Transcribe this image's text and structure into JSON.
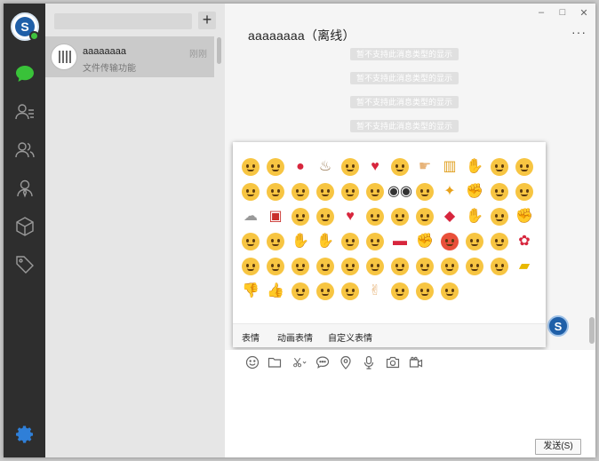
{
  "chat": {
    "title": "aaaaaaaa（离线）",
    "more": "···",
    "unsupported_messages": [
      "暂不支持此消息类型的显示",
      "暂不支持此消息类型的显示",
      "暂不支持此消息类型的显示",
      "暂不支持此消息类型的显示"
    ]
  },
  "window_controls": {
    "minimize": "–",
    "maximize": "□",
    "close": "✕"
  },
  "conversation": {
    "name": "aaaaaaaa",
    "preview": "文件传输功能",
    "time": "刚刚"
  },
  "list": {
    "add_label": "+"
  },
  "emoji_panel": {
    "tabs": [
      "表情",
      "动画表情",
      "自定义表情"
    ],
    "colors": {
      "face": "#f7c542",
      "red": "#d7263d",
      "skin": "#e7b47a"
    },
    "items": [
      "angry-face",
      "kissing-face",
      "balloon",
      "birthday-cake",
      "smiling-face",
      "broken-heart",
      "kiss-face",
      "pointing-hand",
      "beer-mug",
      "handshake",
      "fearful-face",
      "persevering-face",
      "confused-face",
      "crying-face",
      "sad-face",
      "sweating-face",
      "blushing-face",
      "neutral-face",
      "eyes",
      "scream-face",
      "party-popper",
      "raised-fist",
      "astonished-face",
      "frowning-face",
      "ghost",
      "gift",
      "grinning-face",
      "heart-eyes-face",
      "red-heart",
      "joy-face",
      "wink-face",
      "grin-face",
      "lips",
      "clapping-hands",
      "mask-face",
      "flexed-biceps",
      "blank-face",
      "tongue-face",
      "ok-hand",
      "folded-hands",
      "pensive-face",
      "disappointed-face",
      "pill",
      "fist",
      "pouting-face",
      "relieved-face",
      "smirk-face",
      "rose",
      "screaming-face",
      "grimacing-face",
      "sleepy-face",
      "weary-face",
      "beaming-face",
      "unamused-face",
      "sob-face",
      "squinting-face",
      "sunglasses-face",
      "downcast-face",
      "cold-sweat-face",
      "taxi",
      "thumbs-down",
      "thumbs-up",
      "dizzy-face",
      "tired-face",
      "smirking-face",
      "victory-hand",
      "winking-face",
      "worried-face",
      "yum-face"
    ]
  },
  "input": {
    "send_label": "发送(S)"
  }
}
